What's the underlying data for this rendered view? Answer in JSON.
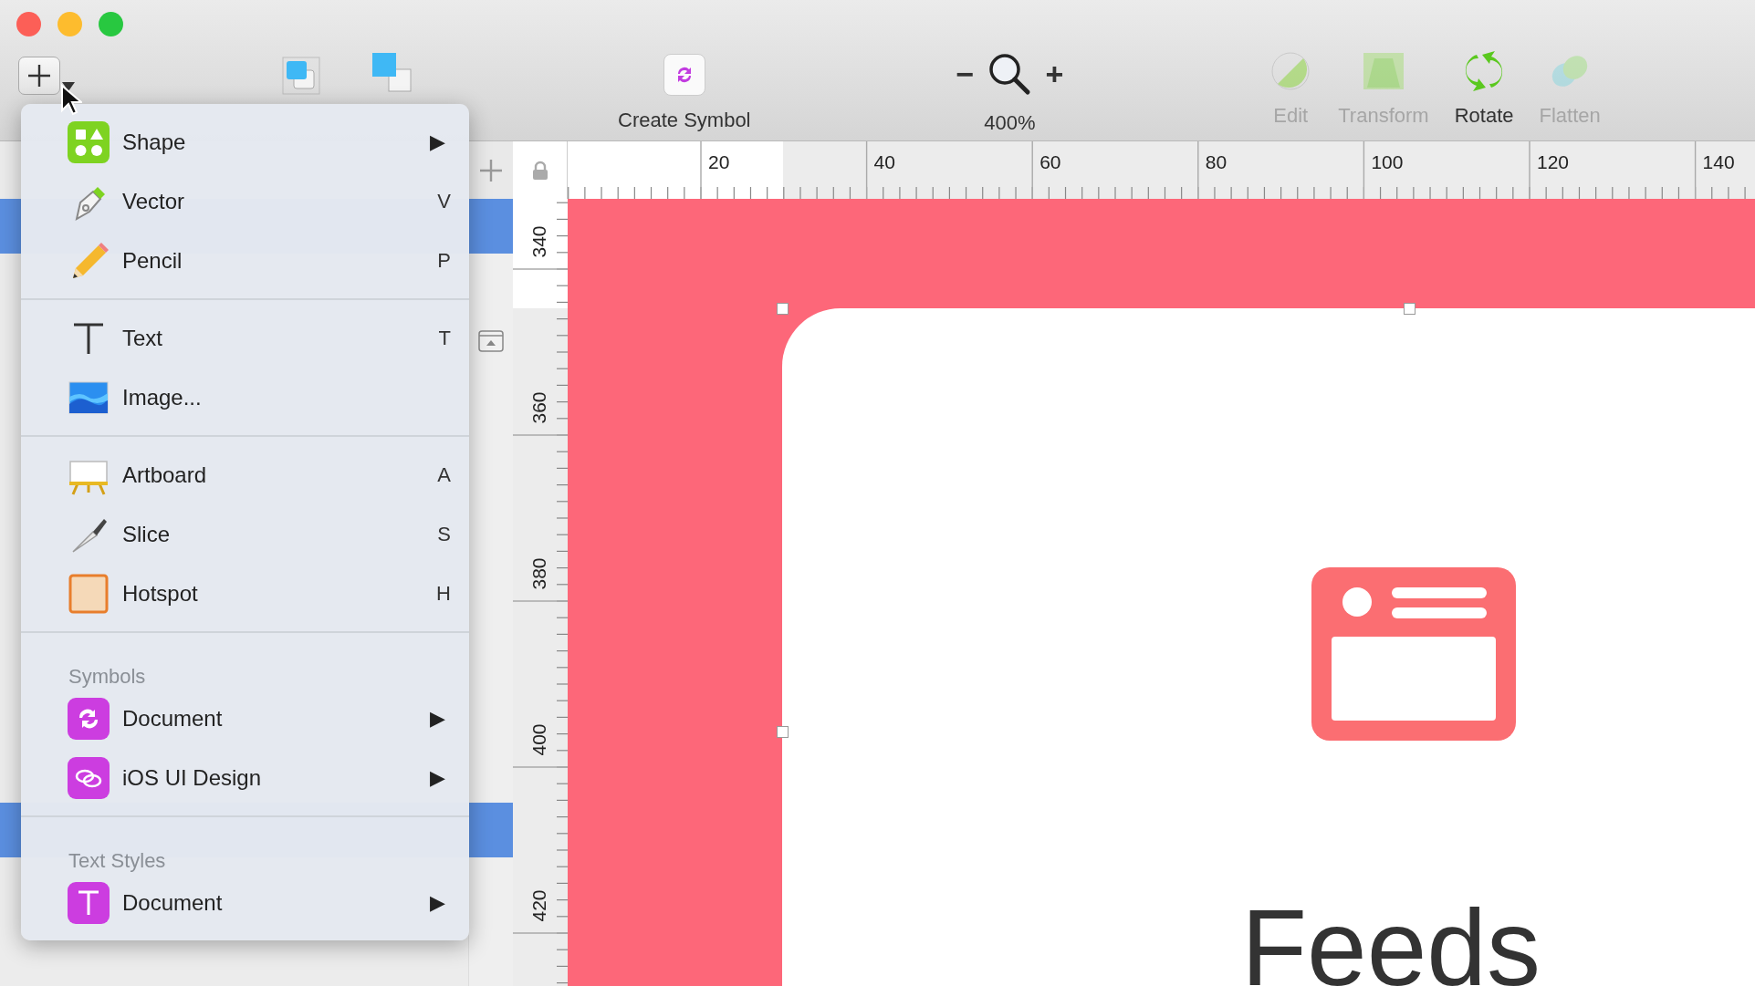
{
  "window": {
    "buttons": [
      {
        "color": "#fc5f57"
      },
      {
        "color": "#fdbc2e"
      },
      {
        "color": "#28c840"
      }
    ]
  },
  "toolbar": {
    "create_symbol": {
      "label": "Create Symbol"
    },
    "zoom": {
      "minus": "−",
      "plus": "+",
      "value": "400%"
    },
    "tools": [
      {
        "label": "Edit",
        "disabled": true
      },
      {
        "label": "Transform",
        "disabled": true
      },
      {
        "label": "Rotate",
        "disabled": false
      },
      {
        "label": "Flatten",
        "disabled": true
      }
    ]
  },
  "insert_menu": {
    "sections": [
      {
        "items": [
          {
            "label": "Shape",
            "arrow": "▶"
          },
          {
            "label": "Vector",
            "shortcut": "V"
          },
          {
            "label": "Pencil",
            "shortcut": "P"
          }
        ]
      },
      {
        "items": [
          {
            "label": "Text",
            "shortcut": "T"
          },
          {
            "label": "Image..."
          }
        ]
      },
      {
        "items": [
          {
            "label": "Artboard",
            "shortcut": "A"
          },
          {
            "label": "Slice",
            "shortcut": "S"
          },
          {
            "label": "Hotspot",
            "shortcut": "H"
          }
        ]
      },
      {
        "header": "Symbols",
        "items": [
          {
            "label": "Document",
            "arrow": "▶"
          },
          {
            "label": "iOS UI Design",
            "arrow": "▶"
          }
        ]
      },
      {
        "header": "Text Styles",
        "items": [
          {
            "label": "Document",
            "arrow": "▶"
          }
        ]
      }
    ]
  },
  "rulers": {
    "horizontal": [
      "20",
      "40",
      "60",
      "80",
      "100",
      "120",
      "140"
    ],
    "vertical": [
      "340",
      "360",
      "380",
      "400",
      "420"
    ]
  },
  "canvas": {
    "title": "Feeds"
  }
}
